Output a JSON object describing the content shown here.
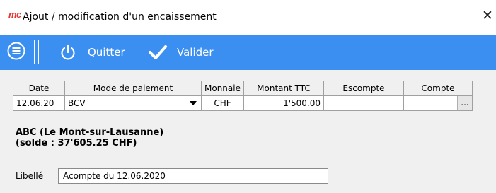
{
  "window": {
    "logo_text": "mc",
    "title": "Ajout / modification d'un encaissement",
    "close_glyph": "✕"
  },
  "toolbar": {
    "icons": [
      "menu-icon",
      "power-icon",
      "check-icon"
    ],
    "quit_label": "Quitter",
    "validate_label": "Valider",
    "background_color": "#3b8ff0"
  },
  "grid": {
    "headers": {
      "date": "Date",
      "mode": "Mode de paiement",
      "currency": "Monnaie",
      "amount": "Montant TTC",
      "discount": "Escompte",
      "account": "Compte"
    },
    "row": {
      "date": "12.06.20",
      "mode": "BCV",
      "currency": "CHF",
      "amount": "1'500.00",
      "discount": "",
      "account": "",
      "account_button": "..."
    }
  },
  "client": {
    "name": "ABC (Le Mont-sur-Lausanne)",
    "balance": "(solde : 37'605.25 CHF)"
  },
  "libelle": {
    "label": "Libellé",
    "value": "Acompte du 12.06.2020"
  }
}
